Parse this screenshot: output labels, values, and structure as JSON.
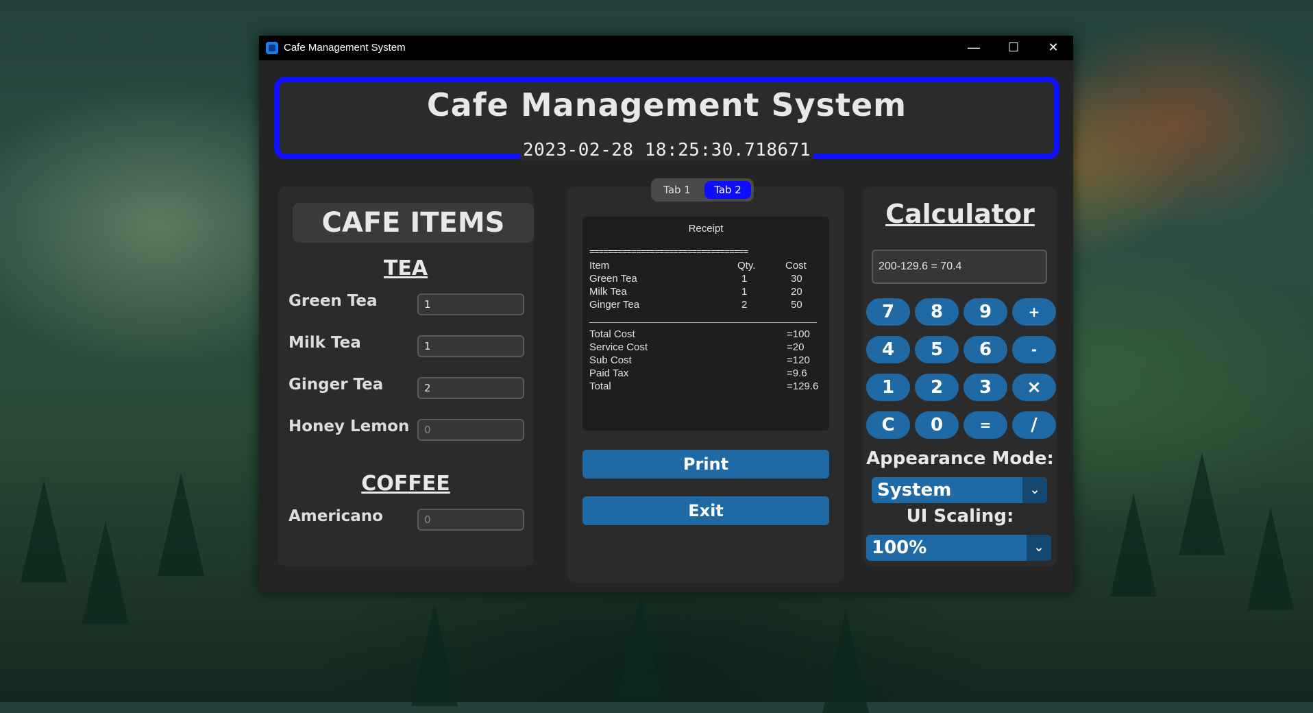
{
  "window": {
    "title": "Cafe Management System",
    "controls": {
      "minimize": "—",
      "maximize": "☐",
      "close": "✕"
    }
  },
  "header": {
    "title": "Cafe Management System",
    "datetime": "2023-02-28 18:25:30.718671"
  },
  "left_panel": {
    "title": "CAFE ITEMS",
    "sections": [
      {
        "title": "TEA",
        "items": [
          {
            "label": "Green Tea",
            "value": "1"
          },
          {
            "label": "Milk Tea",
            "value": "1"
          },
          {
            "label": "Ginger Tea",
            "value": "2"
          },
          {
            "label": "Honey Lemon",
            "value": "0"
          }
        ]
      },
      {
        "title": "COFFEE",
        "items": [
          {
            "label": "Americano",
            "value": "0"
          }
        ]
      }
    ]
  },
  "middle_panel": {
    "tabs": [
      "Tab 1",
      "Tab 2"
    ],
    "active_tab": "Tab 2",
    "receipt": {
      "title": "Receipt",
      "separator": "==================================",
      "headers": {
        "item": "Item",
        "qty": "Qty.",
        "cost": "Cost"
      },
      "rows": [
        {
          "item": "Green Tea",
          "qty": "1",
          "cost": "30"
        },
        {
          "item": "Milk Tea",
          "qty": "1",
          "cost": "20"
        },
        {
          "item": "Ginger Tea",
          "qty": "2",
          "cost": "50"
        }
      ],
      "summary": [
        {
          "label": "Total Cost",
          "value": "=100"
        },
        {
          "label": "Service Cost",
          "value": "=20"
        },
        {
          "label": "Sub Cost",
          "value": "=120"
        },
        {
          "label": "Paid Tax",
          "value": "=9.6"
        },
        {
          "label": "Total",
          "value": "=129.6"
        }
      ]
    },
    "print_label": "Print",
    "exit_label": "Exit"
  },
  "right_panel": {
    "title": "Calculator",
    "display": "200-129.6 = 70.4",
    "keys": [
      [
        "7",
        "8",
        "9",
        "+"
      ],
      [
        "4",
        "5",
        "6",
        "-"
      ],
      [
        "1",
        "2",
        "3",
        "×"
      ],
      [
        "C",
        "0",
        "=",
        "/"
      ]
    ],
    "appearance_label": "Appearance Mode:",
    "appearance_value": "System",
    "scaling_label": "UI Scaling:",
    "scaling_value": "100%"
  },
  "colors": {
    "accent_blue": "#1010ff",
    "button_blue": "#1f6aa5",
    "panel_bg": "#2b2b2b",
    "window_bg": "#242424"
  }
}
